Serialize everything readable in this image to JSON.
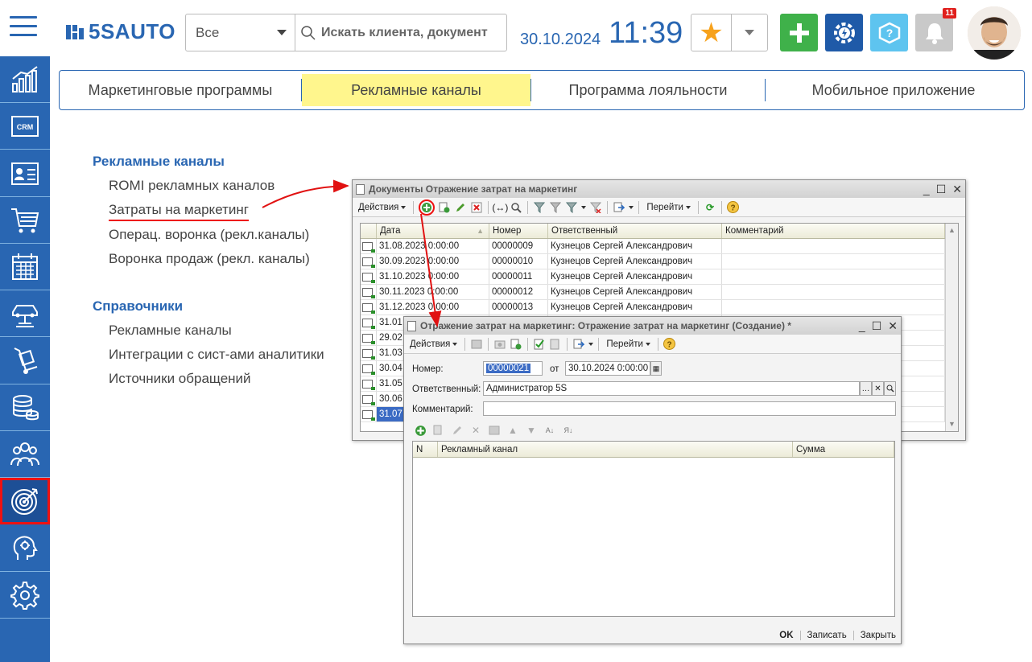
{
  "header": {
    "brand": "5SAUTO",
    "search_scope": "Все",
    "search_placeholder": "Искать клиента, документ",
    "date": "30.10.2024",
    "time": "11:39",
    "notifications_count": "11"
  },
  "tabs": [
    {
      "label": "Маркетинговые программы"
    },
    {
      "label": "Рекламные каналы"
    },
    {
      "label": "Программа лояльности"
    },
    {
      "label": "Мобильное приложение"
    }
  ],
  "menu": {
    "section1_title": "Рекламные каналы",
    "section1_items": [
      "ROMI рекламных каналов",
      "Затраты на маркетинг",
      "Операц. воронка (рекл.каналы)",
      "Воронка продаж (рекл. каналы)"
    ],
    "section2_title": "Справочники",
    "section2_items": [
      "Рекламные каналы",
      "Интеграции с сист-ами аналитики",
      "Источники обращений"
    ]
  },
  "list_window": {
    "title": "Документы Отражение затрат на маркетинг",
    "toolbar_actions": "Действия",
    "toolbar_goto": "Перейти",
    "columns": [
      "Дата",
      "Номер",
      "Ответственный",
      "Комментарий"
    ],
    "rows": [
      {
        "date": "31.08.2023 0:00:00",
        "number": "00000009",
        "resp": "Кузнецов Сергей Александрович"
      },
      {
        "date": "30.09.2023 0:00:00",
        "number": "00000010",
        "resp": "Кузнецов Сергей Александрович"
      },
      {
        "date": "31.10.2023 0:00:00",
        "number": "00000011",
        "resp": "Кузнецов Сергей Александрович"
      },
      {
        "date": "30.11.2023 0:00:00",
        "number": "00000012",
        "resp": "Кузнецов Сергей Александрович"
      },
      {
        "date": "31.12.2023 0:00:00",
        "number": "00000013",
        "resp": "Кузнецов Сергей Александрович"
      },
      {
        "date": "31.01",
        "number": "",
        "resp": ""
      },
      {
        "date": "29.02",
        "number": "",
        "resp": ""
      },
      {
        "date": "31.03",
        "number": "",
        "resp": ""
      },
      {
        "date": "30.04",
        "number": "",
        "resp": ""
      },
      {
        "date": "31.05",
        "number": "",
        "resp": ""
      },
      {
        "date": "30.06",
        "number": "",
        "resp": ""
      },
      {
        "date": "31.07",
        "number": "",
        "resp": ""
      }
    ]
  },
  "form_window": {
    "title": "Отражение затрат на маркетинг: Отражение затрат на маркетинг (Создание) *",
    "toolbar_actions": "Действия",
    "toolbar_goto": "Перейти",
    "number_label": "Номер:",
    "number_value": "00000021",
    "from_label": "от",
    "date_value": "30.10.2024  0:00:00",
    "responsible_label": "Ответственный:",
    "responsible_value": "Администратор 5S",
    "comment_label": "Комментарий:",
    "comment_value": "",
    "table_columns": [
      "N",
      "Рекламный канал",
      "Сумма"
    ],
    "btn_ok": "OK",
    "btn_save": "Записать",
    "btn_close": "Закрыть"
  },
  "colors": {
    "brand_blue": "#2966b2",
    "active_tab": "#fff68d",
    "annotation_red": "#e11111"
  }
}
